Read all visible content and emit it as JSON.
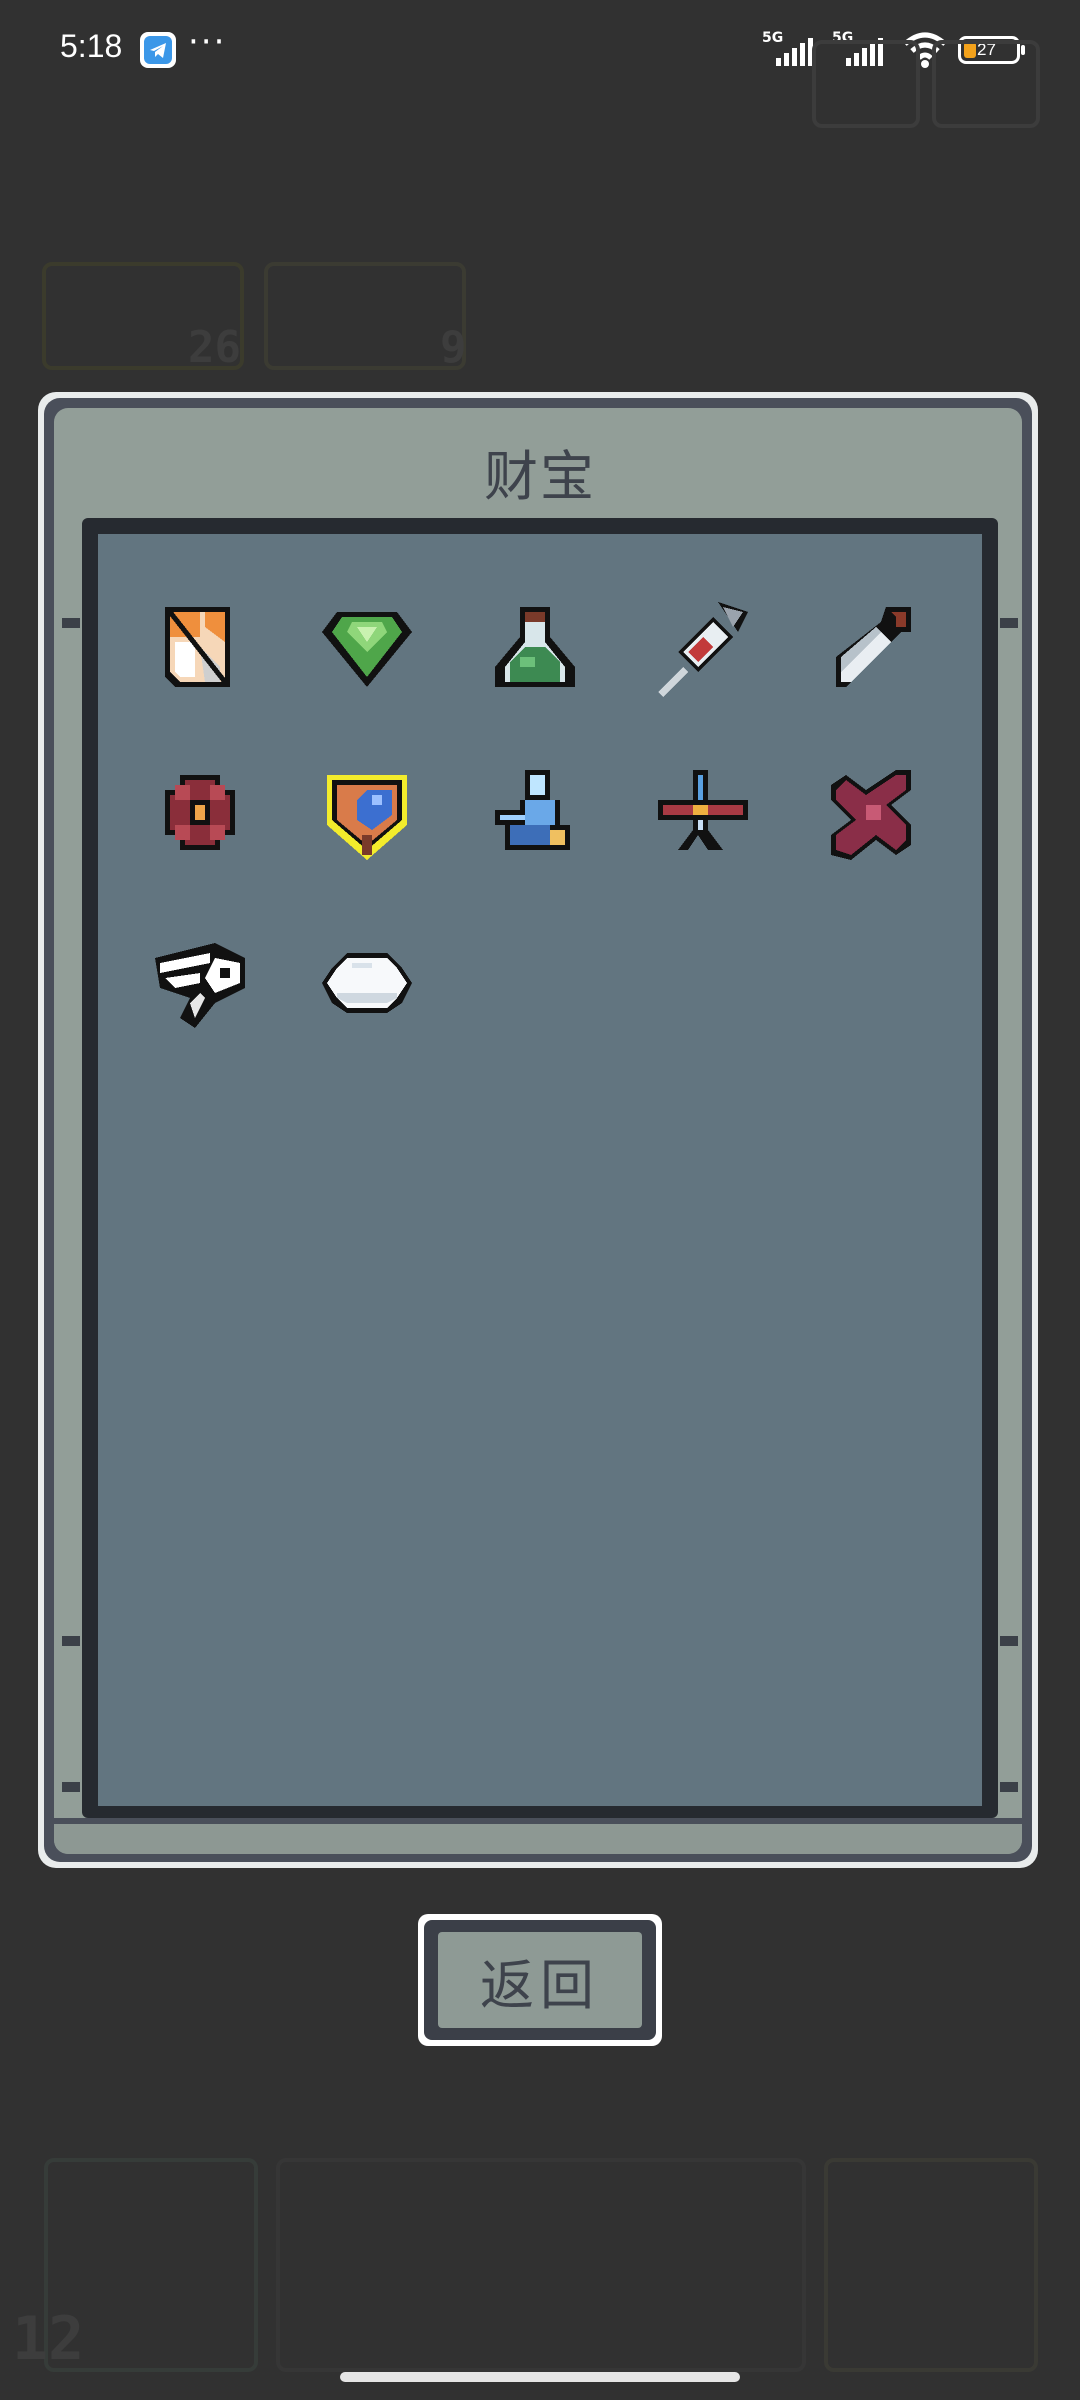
{
  "status_bar": {
    "time": "5:18",
    "signal1_label": "5G",
    "signal2_label": "5G",
    "battery_level": "27",
    "battery_fraction": 0.27
  },
  "dialog": {
    "title": "财宝",
    "items": [
      {
        "name": "scroll-icon"
      },
      {
        "name": "green-gem-icon"
      },
      {
        "name": "potion-flask-icon"
      },
      {
        "name": "syringe-icon"
      },
      {
        "name": "dagger-icon"
      },
      {
        "name": "red-flower-icon"
      },
      {
        "name": "shield-orb-icon"
      },
      {
        "name": "blue-figure-icon"
      },
      {
        "name": "crossbow-icon"
      },
      {
        "name": "red-ribbon-icon"
      },
      {
        "name": "winged-eye-icon"
      },
      {
        "name": "white-egg-icon"
      }
    ],
    "selected_index": 6,
    "back_button_label": "返回"
  },
  "background": {
    "counter_left": "26",
    "counter_mid": "9",
    "counter_bottom": "12"
  }
}
